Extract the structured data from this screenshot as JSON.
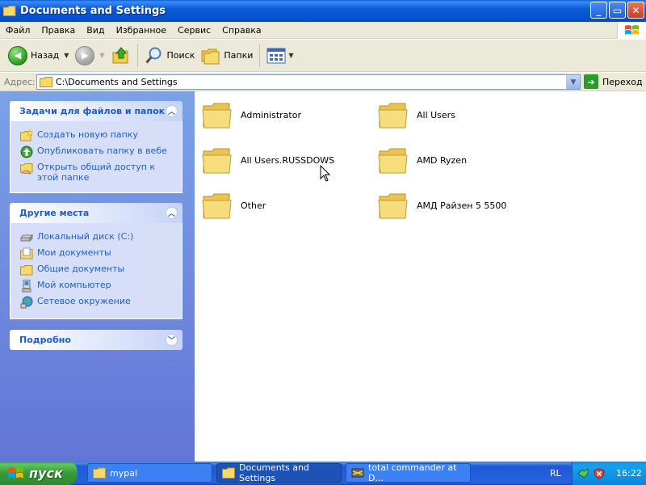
{
  "window": {
    "title": "Documents and Settings",
    "controls": {
      "minimize": "_",
      "maximize": "▭",
      "close": "✕"
    }
  },
  "menu": [
    "Файл",
    "Правка",
    "Вид",
    "Избранное",
    "Сервис",
    "Справка"
  ],
  "toolbar": {
    "back": "Назад",
    "search": "Поиск",
    "folders": "Папки"
  },
  "address": {
    "label": "Адрес:",
    "value": "C:\\Documents and Settings",
    "go": "Переход"
  },
  "sidebar": {
    "tasks": {
      "title": "Задачи для файлов и папок",
      "items": [
        "Создать новую папку",
        "Опубликовать папку в вебе",
        "Открыть общий доступ к этой папке"
      ]
    },
    "places": {
      "title": "Другие места",
      "items": [
        "Локальный диск (C:)",
        "Мои документы",
        "Общие документы",
        "Мой компьютер",
        "Сетевое окружение"
      ]
    },
    "details": {
      "title": "Подробно"
    }
  },
  "folders": [
    "Administrator",
    "All Users",
    "All Users.RUSSDOWS",
    "AMD Ryzen",
    "Other",
    "АМД Райзен 5 5500"
  ],
  "taskbar": {
    "start": "пуск",
    "tasks": [
      "mypal",
      "Documents and Settings",
      "total commander at D..."
    ],
    "language": "RL",
    "clock": "16:22"
  },
  "colors": {
    "titlebar": "#0b5ad8",
    "sidebar_link": "#215dc6",
    "folder_yellow": "#f6dd7a"
  }
}
